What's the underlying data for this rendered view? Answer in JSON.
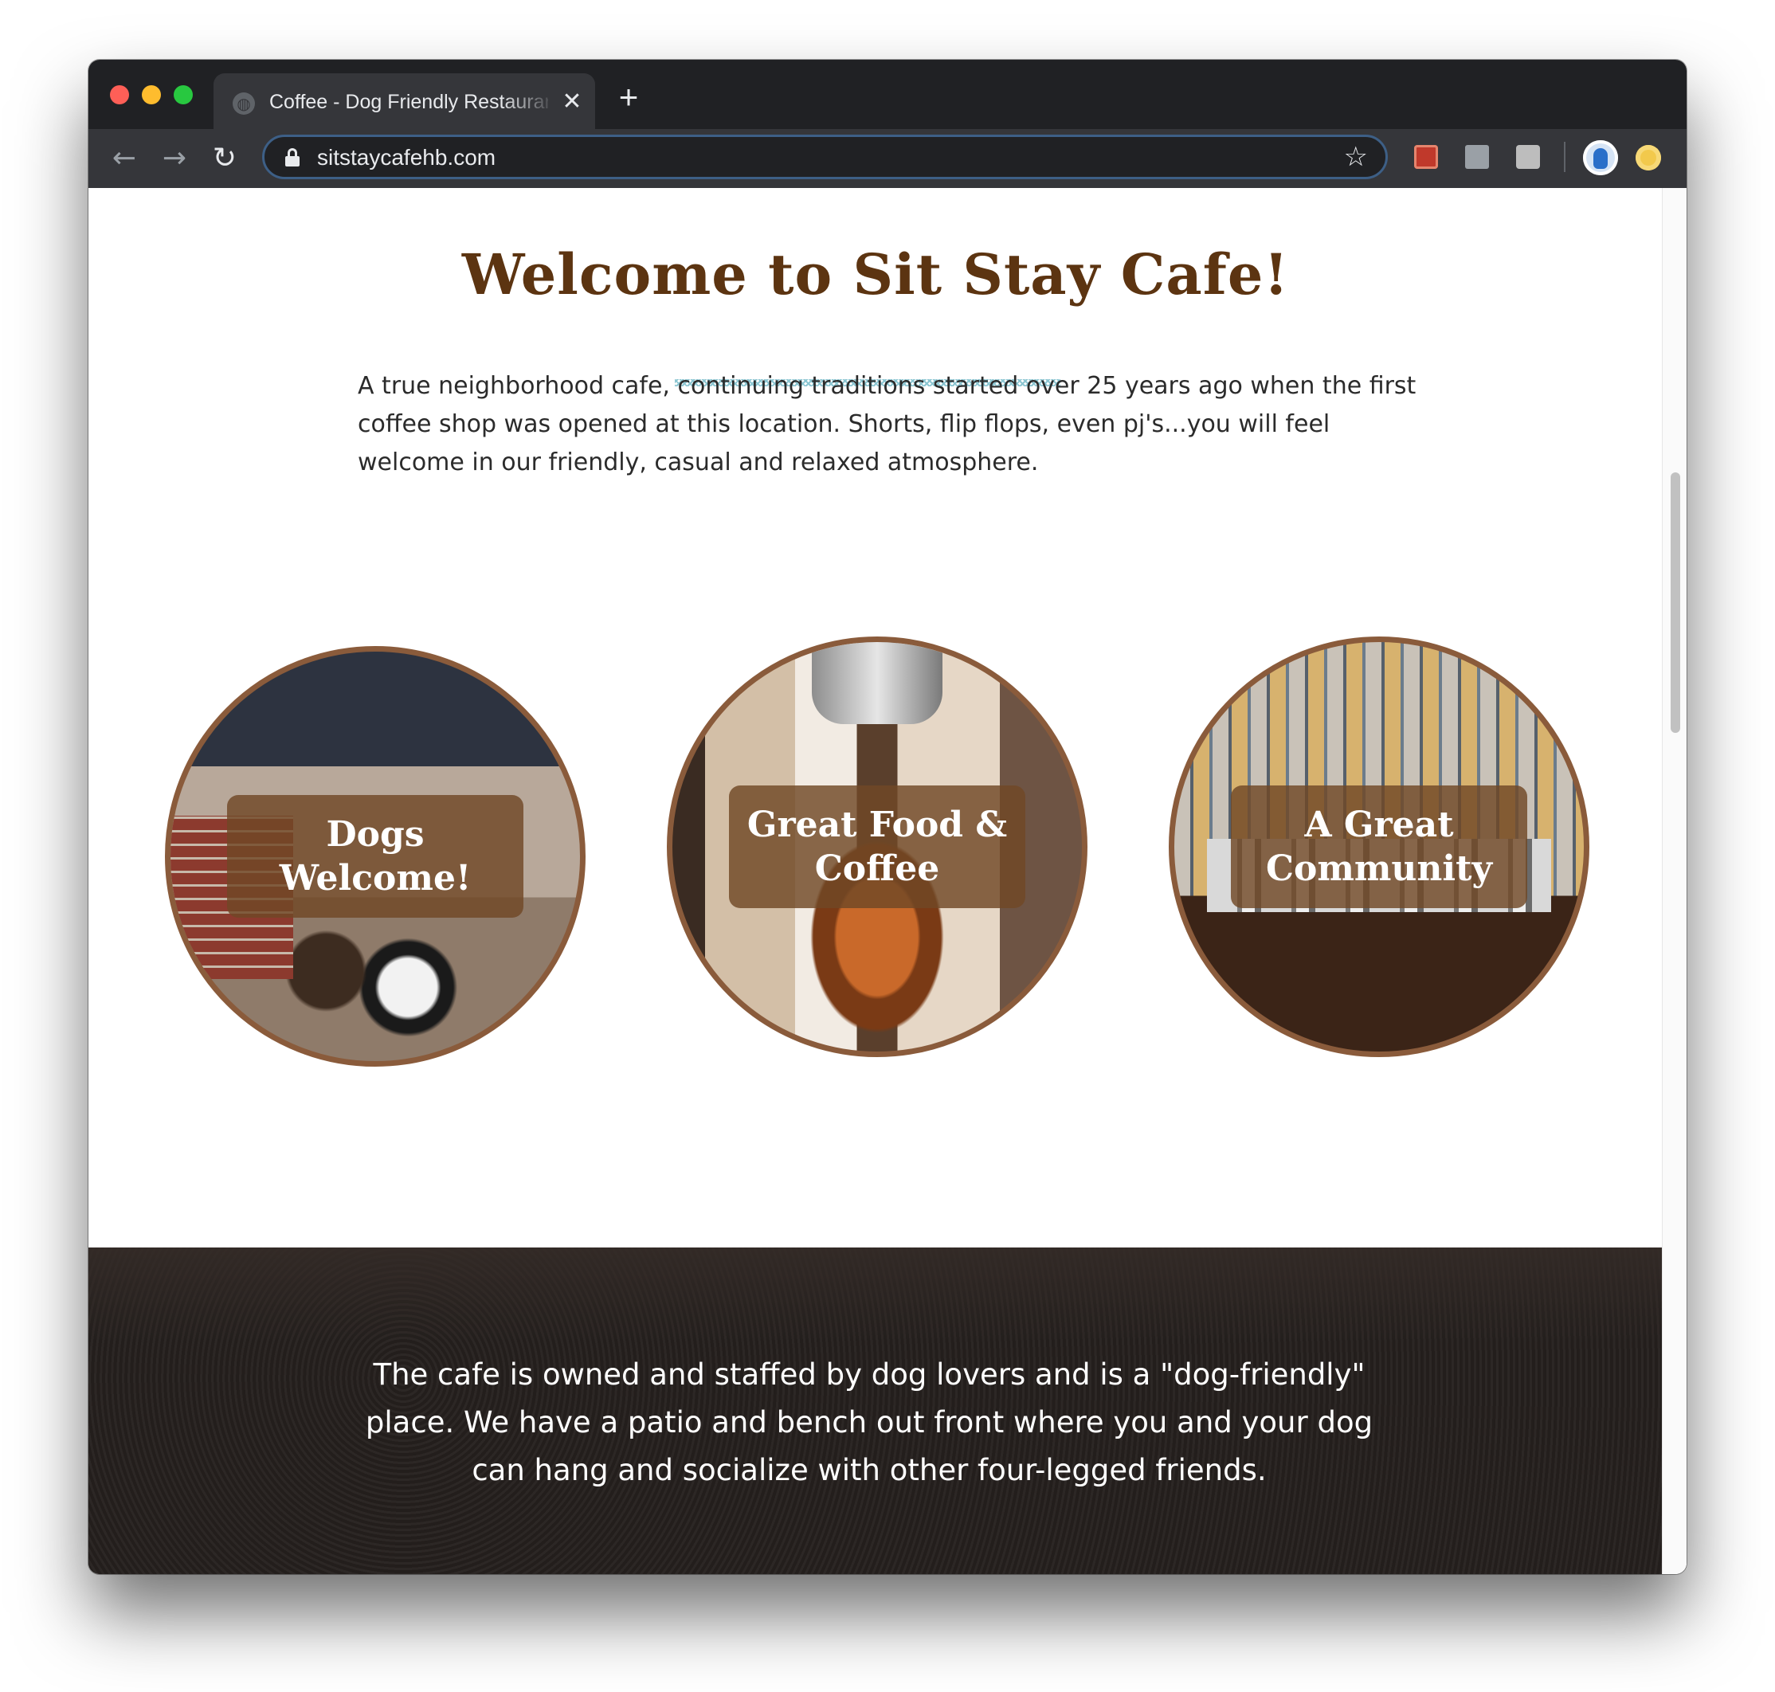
{
  "browser": {
    "tab_title": "Coffee - Dog Friendly Restaurant",
    "tab_close": "✕",
    "new_tab": "+",
    "url": "sitstaycafehb.com",
    "icons": [
      "back-arrow-icon",
      "forward-arrow-icon",
      "reload-icon",
      "lock-icon",
      "star-icon",
      "extension-icons",
      "profile-avatar-icon"
    ]
  },
  "page": {
    "title": "Welcome to Sit Stay Cafe!",
    "intro": "A true neighborhood cafe, continuing traditions started over 25 years ago when the first coffee shop was opened at this location.  Shorts, flip flops, even pj's...you will feel welcome in our friendly, casual and relaxed atmosphere.",
    "features": [
      {
        "label": "Dogs Welcome!"
      },
      {
        "label": "Great Food & Coffee"
      },
      {
        "label": "A Great Community"
      }
    ],
    "banner_text": "The cafe is owned and staffed by dog lovers and is a \"dog-friendly\" place. We have a patio and bench out front where you and your dog can hang and socialize with other four-legged friends."
  },
  "colors": {
    "title_brown": "#5c3411",
    "circle_border": "#8a5b3b",
    "label_bg": "#704826",
    "chrome_dark": "#202124",
    "chrome_toolbar": "#35363a"
  }
}
